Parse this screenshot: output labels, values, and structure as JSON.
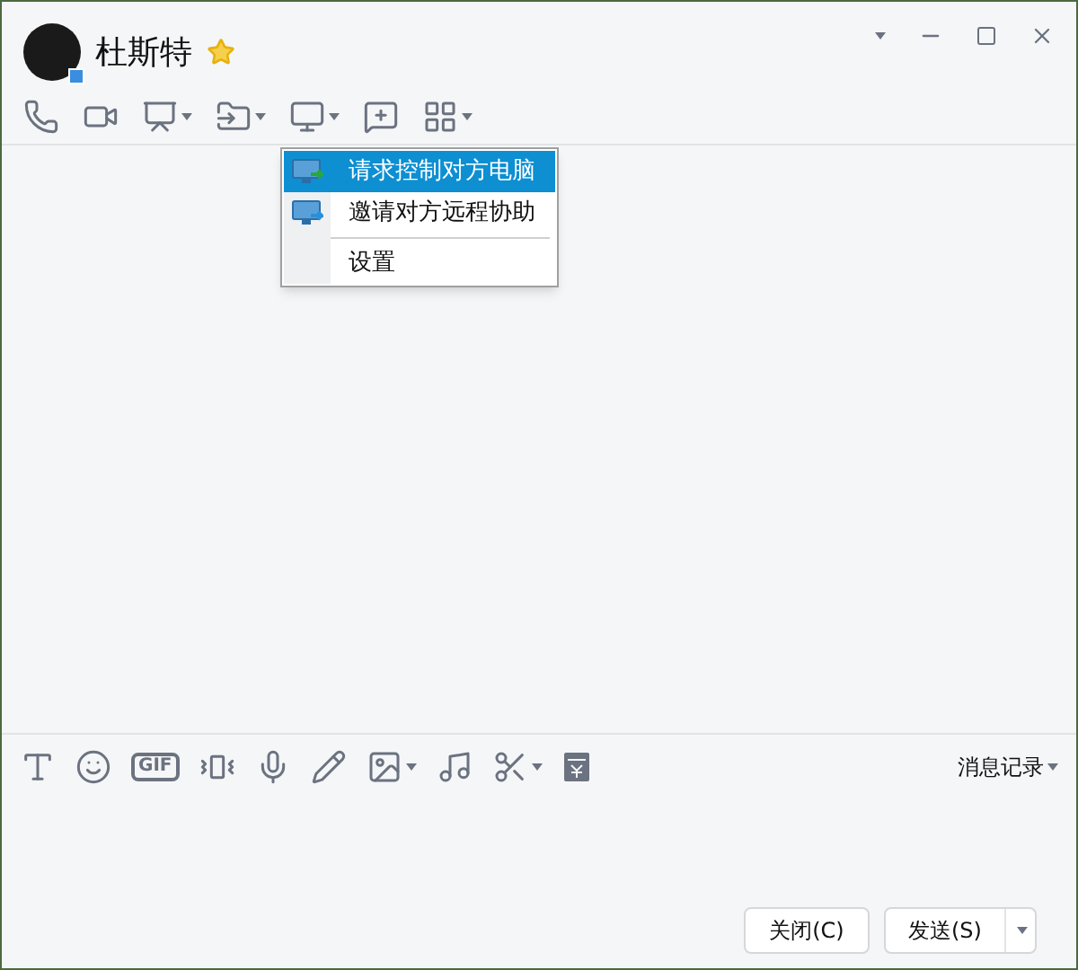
{
  "contact": {
    "name": "杜斯特"
  },
  "remote_menu": {
    "items": [
      {
        "label": "请求控制对方电脑",
        "selected": true,
        "kind": "request"
      },
      {
        "label": "邀请对方远程协助",
        "selected": false,
        "kind": "invite"
      },
      {
        "label": "设置",
        "selected": false,
        "kind": "plain"
      }
    ]
  },
  "input_toolbar": {
    "gif_label": "GIF",
    "history_link": "消息记录"
  },
  "buttons": {
    "close": "关闭(C)",
    "send": "发送(S)"
  }
}
